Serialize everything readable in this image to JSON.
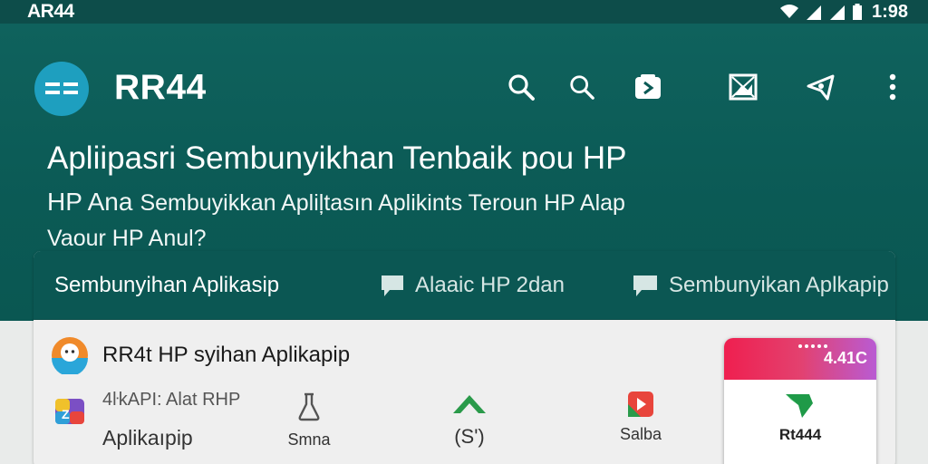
{
  "status_bar": {
    "carrier": "AR44",
    "time": "1:98"
  },
  "app_bar": {
    "title": "RR44"
  },
  "toolbar": {
    "icons": [
      "search-icon",
      "search-icon",
      "play-store-icon",
      "image-icon",
      "send-icon",
      "more-vert-icon"
    ]
  },
  "hero": {
    "headline": "Apliipasri Sembunyikhan Tenbaik pou HP",
    "sub1_strong": "HP  Ana",
    "sub1_rest": "Sembuyikkan Apliļtasın Aplikints Teroun HP Alap",
    "sub2": "Vaour HP Anul?"
  },
  "tabs": [
    {
      "label": "Sembunyihan Aplikasip",
      "icon": ""
    },
    {
      "label": "Alaaic HP 2dan",
      "icon": "chat-icon"
    },
    {
      "label": "Sembunyikan Aplkapip",
      "icon": "chat-icon"
    }
  ],
  "list": {
    "row1_text": "RR4t HP syihan Aplikapip",
    "row2_title": "4ŀkAPI: Alat RHP",
    "row2_sub": "Aplikaıpip"
  },
  "mini_items": [
    {
      "label": "Smna",
      "icon": "flask-icon"
    },
    {
      "label": "(S')",
      "icon": "chevron-up-icon"
    },
    {
      "label": "Salba",
      "icon": "app-icon"
    }
  ],
  "phone_card": {
    "bar_text": "4.41C",
    "name": "Rt444"
  },
  "colors": {
    "primary": "#0d5f5a",
    "accent": "#1e9fbf",
    "card_bg": "#efefef"
  }
}
